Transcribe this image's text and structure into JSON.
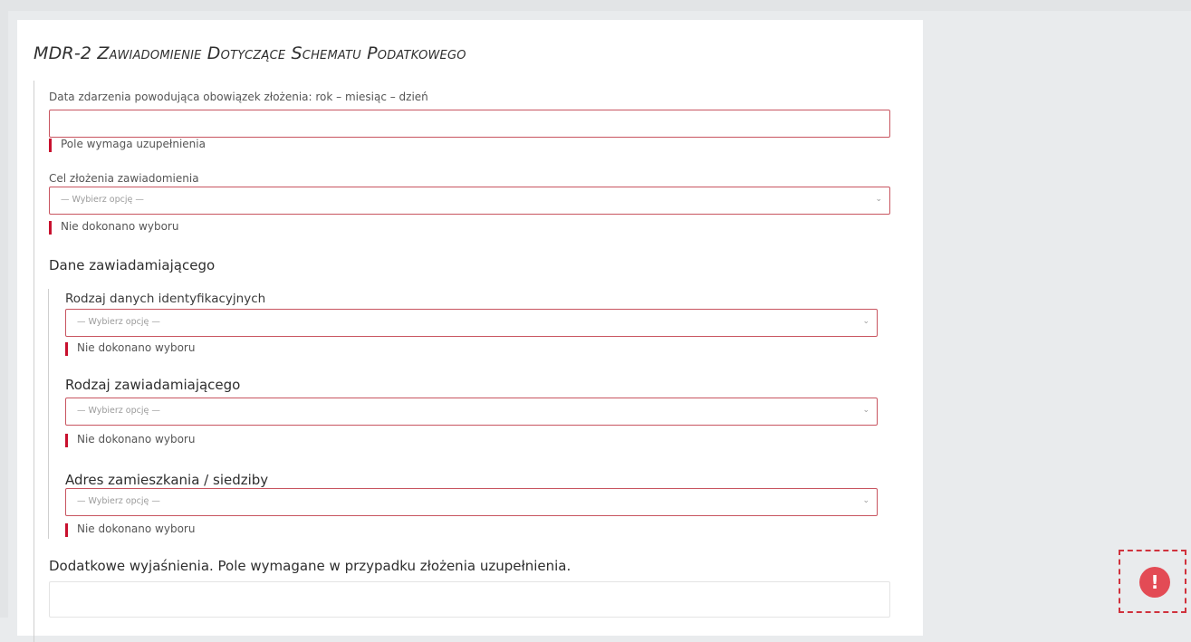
{
  "form": {
    "title_prefix": "MDR-2 ",
    "title_rest": "Zawiadomienie Dotyczące Schematu Podatkowego"
  },
  "fields": {
    "event_date": {
      "label": "Data zdarzenia powodująca obowiązek złożenia: rok – miesiąc – dzień",
      "value": "",
      "error": "Pole wymaga uzupełnienia"
    },
    "purpose": {
      "label": "Cel złożenia zawiadomienia",
      "selected": "— Wybierz opcję —",
      "error": "Nie dokonano wyboru"
    },
    "notifier_section": {
      "heading": "Dane zawiadamiającego"
    },
    "id_type": {
      "label": "Rodzaj danych identyfikacyjnych",
      "selected": "— Wybierz opcję —",
      "error": "Nie dokonano wyboru"
    },
    "notifier_type": {
      "label": "Rodzaj zawiadamiającego",
      "selected": "— Wybierz opcję —",
      "error": "Nie dokonano wyboru"
    },
    "address": {
      "label": "Adres zamieszkania / siedziby",
      "selected": "— Wybierz opcję —",
      "error": "Nie dokonano wyboru"
    },
    "extra_explanations": {
      "label": "Dodatkowe wyjaśnienia. Pole wymagane w przypadku złożenia uzupełnienia.",
      "value": ""
    }
  },
  "alert_button": {
    "icon": "exclamation-icon",
    "glyph": "!"
  },
  "colors": {
    "error": "#c8102e",
    "alert": "#e34b55",
    "page_bg": "#e9ebed"
  }
}
